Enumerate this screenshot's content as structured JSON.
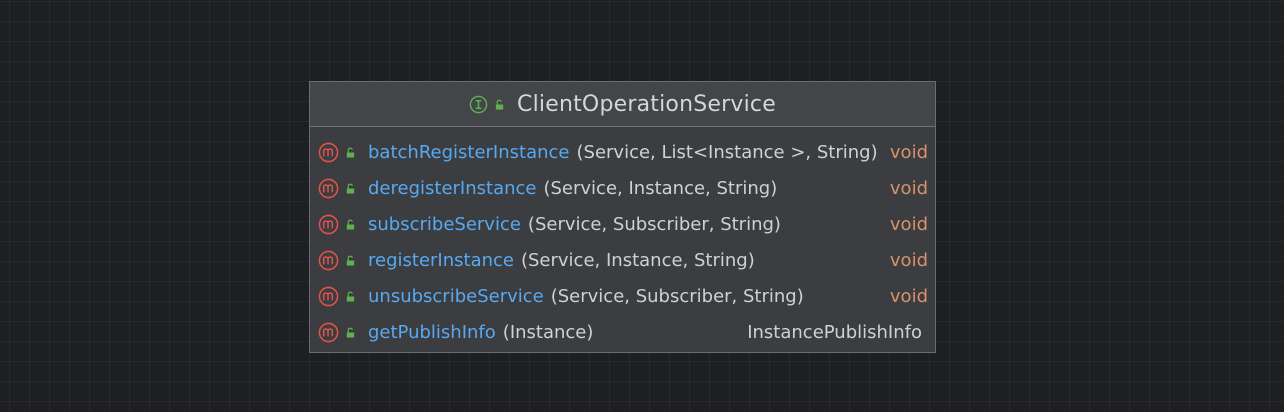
{
  "diagram": {
    "class_name": "ClientOperationService",
    "header_icons": [
      "interface-icon",
      "public-lock-icon"
    ],
    "methods": [
      {
        "name": "batchRegisterInstance",
        "params": "(Service, List<Instance >, String)",
        "returns": "void",
        "icon": "method-icon",
        "visibility_icon": "public-lock-icon"
      },
      {
        "name": "deregisterInstance",
        "params": "(Service, Instance, String)",
        "returns": "void",
        "icon": "method-icon",
        "visibility_icon": "public-lock-icon"
      },
      {
        "name": "subscribeService",
        "params": "(Service, Subscriber, String)",
        "returns": "void",
        "icon": "method-icon",
        "visibility_icon": "public-lock-icon"
      },
      {
        "name": "registerInstance",
        "params": "(Service, Instance, String)",
        "returns": "void",
        "icon": "method-icon",
        "visibility_icon": "public-lock-icon"
      },
      {
        "name": "unsubscribeService",
        "params": "(Service, Subscriber, String)",
        "returns": "void",
        "icon": "method-icon",
        "visibility_icon": "public-lock-icon"
      },
      {
        "name": "getPublishInfo",
        "params": "(Instance)",
        "returns": "InstancePublishInfo",
        "icon": "method-icon",
        "visibility_icon": "public-lock-icon"
      }
    ],
    "colors": {
      "background": "#1e1f22",
      "node_body": "#3b3d41",
      "node_header": "#434548",
      "method_name": "#58a9f0",
      "keyword_return": "#d9916b",
      "method_icon": "#e0524c",
      "lock_icon": "#5fb04f"
    }
  }
}
